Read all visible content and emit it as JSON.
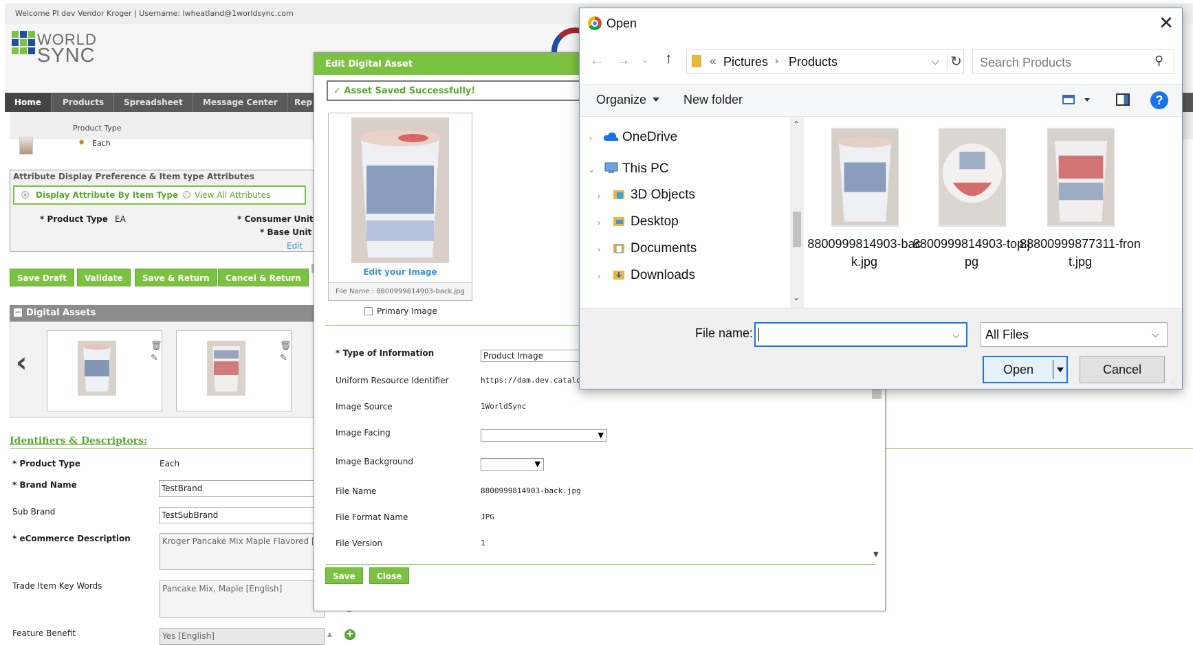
{
  "app": {
    "welcome_text": "Welcome PI dev Vendor Kroger | Username: lwheatland@1worldsync.com",
    "logo_world": "WORLD",
    "logo_sync": "SYNC",
    "brand_green": "#7cc242",
    "brand_blue": "#1f4f9e",
    "nav": {
      "items": [
        {
          "label": "Home"
        },
        {
          "label": "Products"
        },
        {
          "label": "Spreadsheet"
        },
        {
          "label": "Message Center"
        },
        {
          "label": "Rep"
        }
      ]
    },
    "product_type_label": "Product Type",
    "product_type_value": "Each",
    "attr_panel": {
      "title": "Attribute Display Preference & Item type Attributes",
      "radio_by_type": "Display Attribute By Item Type",
      "radio_view_all": "View All Attributes",
      "product_type_label": "* Product Type",
      "product_type_value": "EA",
      "consumer_unit_label": "* Consumer Unit",
      "base_unit_label": "* Base Unit",
      "edit_link": "Edit"
    },
    "actions": {
      "save_draft": "Save Draft",
      "validate": "Validate",
      "save_return": "Save & Return",
      "cancel_return": "Cancel & Return"
    },
    "digital_assets": {
      "toggle": "−",
      "title": "Digital Assets",
      "prev_icon": "chevron-left-icon"
    },
    "identifiers": {
      "title": "Identifiers & Descriptors:",
      "product_type_label": "* Product Type",
      "product_type_value": "Each",
      "brand_name_label": "* Brand Name",
      "brand_name_value": "TestBrand",
      "sub_brand_label": "Sub Brand",
      "sub_brand_value": "TestSubBrand",
      "ecommerce_label": "* eCommerce Description",
      "ecommerce_value": "Kroger Pancake Mix Maple Flavored [E",
      "keywords_label": "Trade Item Key Words",
      "keywords_value": "Pancake Mix, Maple [English]",
      "feature_benefit_label": "Feature Benefit",
      "feature_benefit_value": "Yes [English]"
    }
  },
  "edit_dialog": {
    "title": "Edit Digital Asset",
    "success": "✓ Asset Saved Successfully!",
    "edit_image_link": "Edit your Image",
    "file_name_caption": "File Name : 8800999814903-back.jpg",
    "primary_image_label": "Primary Image",
    "fields": {
      "type_label": "* Type of Information",
      "type_value": "Product Image",
      "uri_label": "Uniform Resource Identifier",
      "uri_value": "https://dam.dev.catalog.",
      "source_label": "Image Source",
      "source_value": "1WorldSync",
      "facing_label": "Image Facing",
      "background_label": "Image Background",
      "file_name_label": "File Name",
      "file_name_value": "8800999814903-back.jpg",
      "format_label": "File Format Name",
      "format_value": "JPG",
      "version_label": "File Version",
      "version_value": "1"
    },
    "save_button": "Save",
    "close_button": "Close"
  },
  "open_dialog": {
    "title": "Open",
    "breadcrumb": {
      "chev0": "«",
      "pictures": "Pictures",
      "chev1": "›",
      "products": "Products"
    },
    "search_placeholder": "Search Products",
    "organize": "Organize",
    "new_folder": "New folder",
    "help": "?",
    "nav_items": [
      {
        "label": "OneDrive",
        "icon": "cloud-icon"
      },
      {
        "label": "This PC",
        "icon": "computer-icon"
      },
      {
        "label": "3D Objects",
        "icon": "folder-icon"
      },
      {
        "label": "Desktop",
        "icon": "folder-icon"
      },
      {
        "label": "Documents",
        "icon": "document-folder-icon"
      },
      {
        "label": "Downloads",
        "icon": "download-folder-icon"
      }
    ],
    "files": [
      {
        "name": "8800999814903-back.jpg"
      },
      {
        "name": "8800999814903-top.jpg"
      },
      {
        "name": "88800999877311-front.jpg"
      }
    ],
    "file_name_label": "File name:",
    "file_name_value": "",
    "filter_value": "All Files",
    "open_button": "Open",
    "cancel_button": "Cancel"
  }
}
